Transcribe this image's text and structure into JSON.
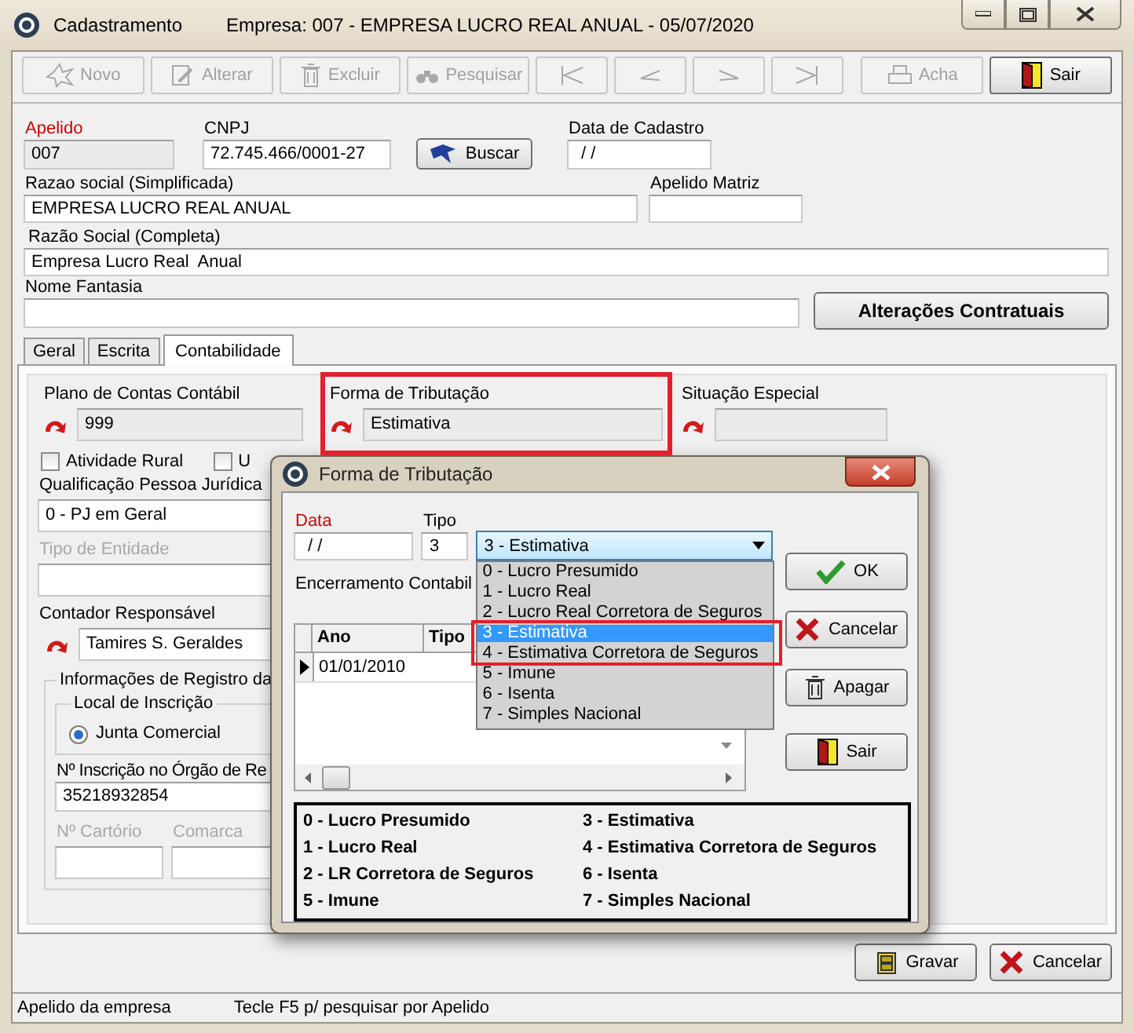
{
  "window": {
    "title": "Cadastramento",
    "subtitle": "Empresa: 007 - EMPRESA LUCRO REAL ANUAL - 05/07/2020"
  },
  "toolbar": [
    {
      "kind": "new",
      "label": "Novo",
      "disabled": true
    },
    {
      "kind": "edit",
      "label": "Alterar",
      "disabled": true
    },
    {
      "kind": "delete",
      "label": "Excluir",
      "disabled": true
    },
    {
      "kind": "search",
      "label": "Pesquisar",
      "disabled": true
    },
    {
      "kind": "first",
      "disabled": true
    },
    {
      "kind": "prev",
      "disabled": true
    },
    {
      "kind": "next",
      "disabled": true
    },
    {
      "kind": "last",
      "disabled": true
    },
    {
      "kind": "find",
      "label": "Acha",
      "disabled": true
    },
    {
      "kind": "exit",
      "label": "Sair",
      "disabled": false
    }
  ],
  "company": {
    "apelido": {
      "label": "Apelido",
      "value": "007",
      "required": true
    },
    "cnpj": {
      "label": "CNPJ",
      "value": "72.745.466/0001-27"
    },
    "buscar_button": "Buscar",
    "data_cadastro": {
      "label": "Data de Cadastro",
      "value": "/ /"
    },
    "razao_simplificada": {
      "label": "Razao social (Simplificada)",
      "value": "EMPRESA LUCRO REAL ANUAL"
    },
    "apelido_matriz": {
      "label": "Apelido Matriz"
    },
    "razao_completa": {
      "label": "Razão Social (Completa)",
      "value": "Empresa Lucro Real  Anual"
    },
    "nome_fantasia": {
      "label": "Nome Fantasia"
    },
    "alteracoes_button": "Alterações Contratuais"
  },
  "tabs": [
    {
      "label": "Geral",
      "selected": false
    },
    {
      "label": "Escrita",
      "selected": false
    },
    {
      "label": "Contabilidade",
      "selected": true
    }
  ],
  "contabilidade": {
    "plano": {
      "label": "Plano de Contas Contábil",
      "value": "999"
    },
    "forma": {
      "label": "Forma de Tributação",
      "value": "Estimativa"
    },
    "situacao": {
      "label": "Situação Especial"
    },
    "checkboxes": [
      {
        "label": "Atividade Rural",
        "checked": false
      },
      {
        "label": "U",
        "checked": false
      }
    ],
    "qualificacao": {
      "label": "Qualificação Pessoa Jurídica",
      "value": "0 - PJ em Geral"
    },
    "tipo_entidade": {
      "label": "Tipo de Entidade",
      "disabled": true
    },
    "contador": {
      "label": "Contador Responsável",
      "value": "Tamires S. Geraldes"
    },
    "registro": {
      "title": "Informações de Registro da",
      "local": {
        "title": "Local de Inscrição",
        "options": [
          {
            "label": "Junta Comercial",
            "selected": true
          }
        ]
      },
      "inscricao": {
        "label": "Nº Inscrição no Órgão de Re",
        "value": "35218932854"
      },
      "cartorio": {
        "label": "Nº Cartório",
        "disabled": true
      },
      "comarca": {
        "label": "Comarca",
        "disabled": true
      }
    }
  },
  "footer_buttons": [
    {
      "kind": "save",
      "label": "Gravar"
    },
    {
      "kind": "cancel",
      "label": "Cancelar"
    }
  ],
  "status_bar": [
    "Apelido da empresa",
    "Tecle F5 p/ pesquisar por Apelido"
  ],
  "dialog": {
    "title": "Forma de Tributação",
    "data": {
      "label": "Data",
      "value": "/ /",
      "required": true
    },
    "tipo": {
      "label": "Tipo",
      "value": "3"
    },
    "combo": {
      "value": "3 - Estimativa",
      "expanded": true,
      "options": [
        {
          "label": "0 - Lucro Presumido",
          "selected": false
        },
        {
          "label": "1 - Lucro Real",
          "selected": false
        },
        {
          "label": "2 - Lucro Real Corretora de Seguros",
          "selected": false
        },
        {
          "label": "3 - Estimativa",
          "selected": true
        },
        {
          "label": "4 - Estimativa Corretora de Seguros",
          "selected": false
        },
        {
          "label": "5 - Imune",
          "selected": false
        },
        {
          "label": "6 - Isenta",
          "selected": false
        },
        {
          "label": "7 - Simples Nacional",
          "selected": false
        }
      ]
    },
    "encerramento_label": "Encerramento Contabil",
    "grid": {
      "columns": [
        "Ano",
        "Tipo"
      ],
      "rows": [
        {
          "cells": [
            "01/01/2010"
          ],
          "current": true
        }
      ]
    },
    "buttons": [
      {
        "kind": "ok",
        "label": "OK"
      },
      {
        "kind": "cancel",
        "label": "Cancelar"
      },
      {
        "kind": "delete",
        "label": "Apagar"
      },
      {
        "kind": "exit",
        "label": "Sair"
      }
    ],
    "legend": [
      "0 - Lucro Presumido",
      "3 - Estimativa",
      "1 - Lucro Real",
      "4 - Estimativa Corretora de Seguros",
      "2 - LR Corretora de Seguros",
      "6 - Isenta",
      "5 - Imune",
      "7 - Simples Nacional"
    ]
  },
  "annotations": [
    {
      "kind": "highlight",
      "color": "#e3202b"
    },
    {
      "kind": "highlight",
      "color": "#e3202b"
    }
  ]
}
